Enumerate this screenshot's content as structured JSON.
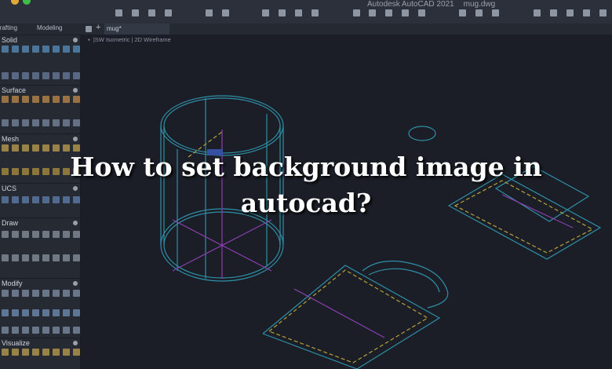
{
  "window": {
    "app_title": "Autodesk AutoCAD 2021",
    "file_name": "mug.dwg"
  },
  "palette_tabs": [
    {
      "label": "Drafting"
    },
    {
      "label": "Modeling"
    }
  ],
  "document_tab": {
    "label": "mug*"
  },
  "viewport_label": {
    "view": "SW Isometric",
    "style": "2D Wireframe"
  },
  "palette_sections": [
    {
      "label": "Solid"
    },
    {
      "label": "Surface"
    },
    {
      "label": "Mesh"
    },
    {
      "label": "UCS"
    },
    {
      "label": "Draw"
    },
    {
      "label": "Modify"
    },
    {
      "label": "Visualize"
    }
  ],
  "headline": {
    "line1": "How to set background image in",
    "line2": "autocad?"
  },
  "colors": {
    "cyan": "#2f8fa6",
    "magenta": "#8a3fb0",
    "yellow": "#b5a23a",
    "background": "#1b1e26"
  }
}
